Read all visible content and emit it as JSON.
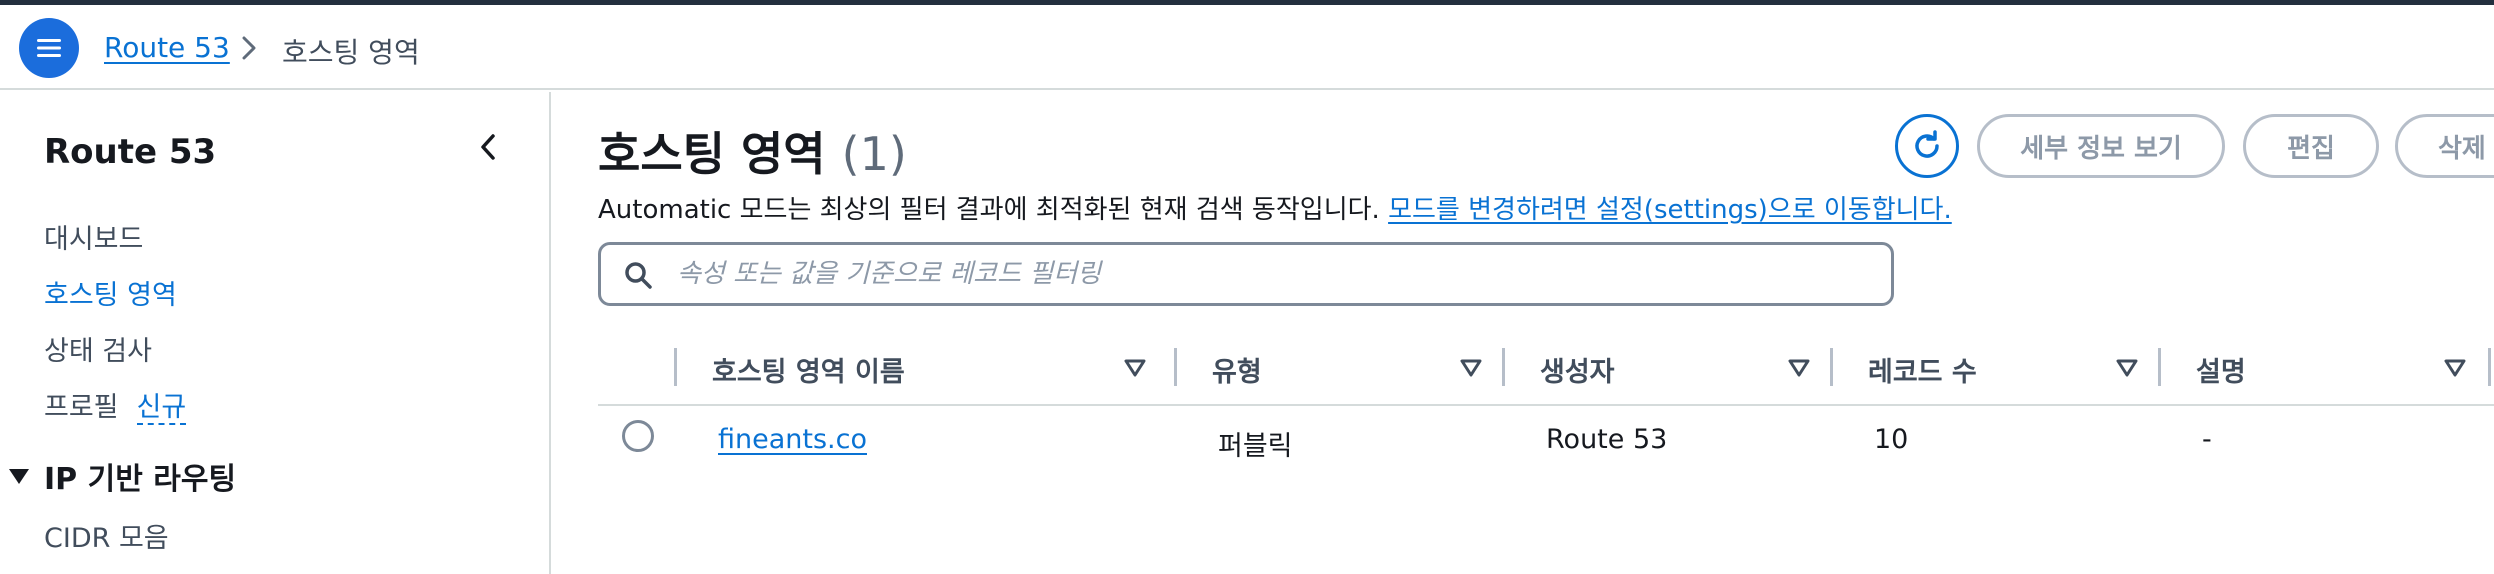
{
  "breadcrumb": {
    "root": "Route 53",
    "current": "호스팅 영역"
  },
  "sidebar": {
    "title": "Route 53",
    "items": [
      {
        "label": "대시보드"
      },
      {
        "label": "호스팅 영역"
      },
      {
        "label": "상태 검사"
      },
      {
        "label": "프로필",
        "badge": "신규"
      }
    ],
    "group": {
      "label": "IP 기반 라우팅",
      "items": [
        {
          "label": "CIDR 모음"
        }
      ]
    }
  },
  "main": {
    "title": "호스팅 영역",
    "count": "(1)",
    "info_text": "Automatic 모드는 최상의 필터 결과에 최적화된 현재 검색 동작입니다.",
    "info_link": "모드를 변경하려면 설정(settings)으로 이동합니다.",
    "buttons": {
      "details": "세부 정보 보기",
      "edit": "편집",
      "delete": "삭제"
    },
    "search": {
      "placeholder": "속성 또는 값을 기준으로 레코드 필터링",
      "value": ""
    }
  },
  "table": {
    "columns": [
      "호스팅 영역 이름",
      "유형",
      "생성자",
      "레코드 수",
      "설명"
    ],
    "rows": [
      {
        "name": "fineants.co",
        "type": "퍼블릭",
        "created_by": "Route 53",
        "record_count": "10",
        "description": "-"
      }
    ]
  },
  "colors": {
    "accent": "#0972d3",
    "menu_button": "#1b6ddc",
    "disabled_text": "#8d99a8",
    "border": "#d5dbdb"
  },
  "icons": {
    "menu": "menu-icon",
    "chevron": "chevron-right-icon",
    "collapse": "chevron-left-icon",
    "refresh": "refresh-icon",
    "search": "search-icon",
    "sort": "sort-down-icon",
    "group": "caret-down-icon"
  }
}
